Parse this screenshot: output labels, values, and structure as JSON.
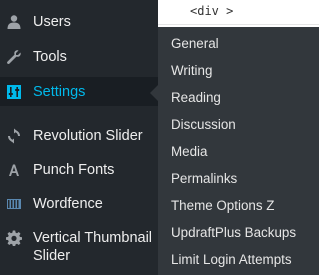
{
  "sidebar": {
    "items": [
      {
        "label": "Users",
        "icon": "user-icon"
      },
      {
        "label": "Tools",
        "icon": "wrench-icon"
      },
      {
        "label": "Settings",
        "icon": "settings-sliders-icon"
      },
      {
        "label": "Revolution Slider",
        "icon": "refresh-icon"
      },
      {
        "label": "Punch Fonts",
        "icon": "letter-a-icon"
      },
      {
        "label": "Wordfence",
        "icon": "wordfence-icon"
      },
      {
        "label": "Vertical Thumbnail Slider",
        "icon": "gear-icon"
      }
    ]
  },
  "editor": {
    "code_text": "<div >"
  },
  "settings_submenu": {
    "items": [
      {
        "label": "General"
      },
      {
        "label": "Writing"
      },
      {
        "label": "Reading"
      },
      {
        "label": "Discussion"
      },
      {
        "label": "Media"
      },
      {
        "label": "Permalinks"
      },
      {
        "label": "Theme Options Z"
      },
      {
        "label": "UpdraftPlus Backups"
      },
      {
        "label": "Limit Login Attempts"
      }
    ]
  },
  "colors": {
    "sidebar_bg": "#23282d",
    "flyout_bg": "#32373c",
    "active_text": "#00b9eb",
    "text": "#eeeeee"
  }
}
